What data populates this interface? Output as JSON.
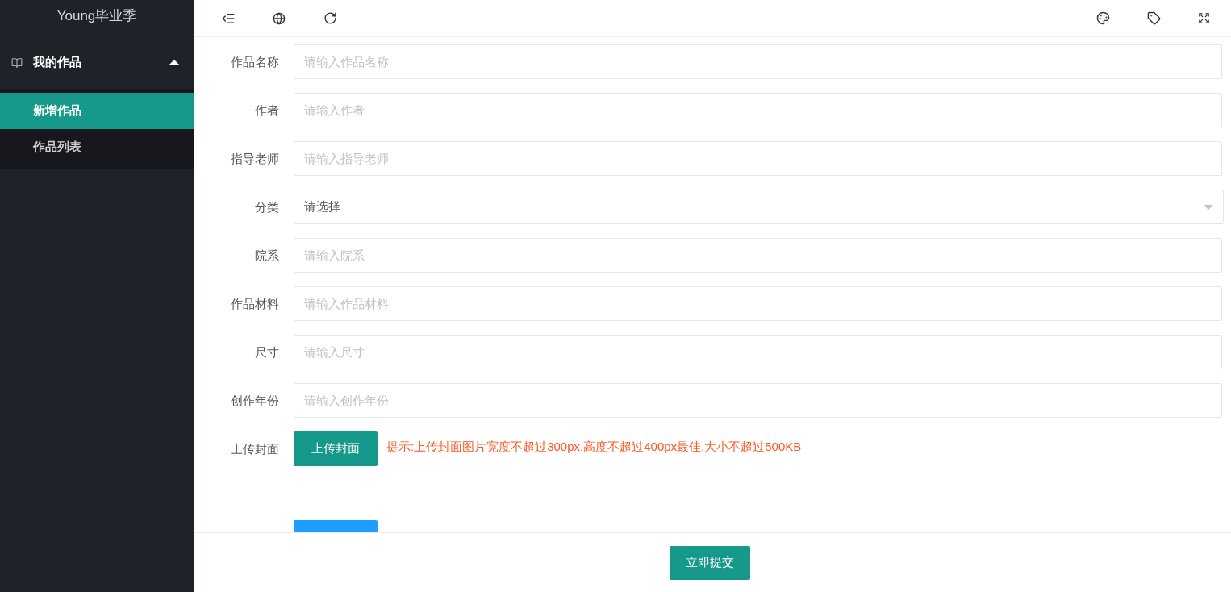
{
  "sidebar": {
    "title": "Young毕业季",
    "menu": {
      "label": "我的作品",
      "expanded": true,
      "children": [
        {
          "label": "新增作品",
          "selected": true
        },
        {
          "label": "作品列表",
          "selected": false
        }
      ]
    }
  },
  "form": {
    "fields": [
      {
        "kind": "input",
        "label": "作品名称",
        "placeholder": "请输入作品名称"
      },
      {
        "kind": "input",
        "label": "作者",
        "placeholder": "请输入作者"
      },
      {
        "kind": "input",
        "label": "指导老师",
        "placeholder": "请输入指导老师"
      },
      {
        "kind": "select",
        "label": "分类",
        "placeholder": "请选择"
      },
      {
        "kind": "input",
        "label": "院系",
        "placeholder": "请输入院系"
      },
      {
        "kind": "input",
        "label": "作品材料",
        "placeholder": "请输入作品材料"
      },
      {
        "kind": "input",
        "label": "尺寸",
        "placeholder": "请输入尺寸"
      },
      {
        "kind": "input",
        "label": "创作年份",
        "placeholder": "请输入创作年份"
      },
      {
        "kind": "upload",
        "label": "上传封面",
        "button": "上传封面",
        "hint": "提示:上传封面图片宽度不超过300px,高度不超过400px最佳,大小不超过500KB"
      },
      {
        "kind": "upload-cut"
      }
    ]
  },
  "footer": {
    "submit": "立即提交"
  }
}
